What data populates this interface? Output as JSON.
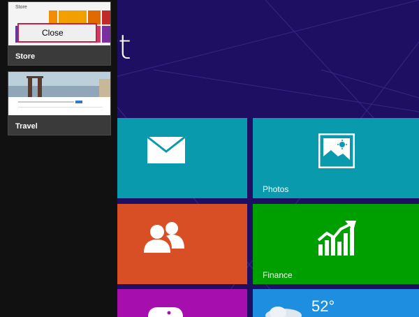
{
  "start": {
    "title": "art"
  },
  "tiles": {
    "mail": {
      "label": "",
      "icon": "mail-icon",
      "color": "#0a9aad"
    },
    "photos": {
      "label": "Photos",
      "icon": "photos-icon",
      "color": "#0a9aad"
    },
    "people": {
      "label": "",
      "icon": "people-icon",
      "color": "#d84f26"
    },
    "finance": {
      "label": "Finance",
      "icon": "finance-chart-icon",
      "color": "#009f00"
    },
    "games": {
      "label": "",
      "icon": "games-icon",
      "color": "#a60fae"
    },
    "weather": {
      "label": "",
      "temperature": "52°",
      "icon": "cloud-icon",
      "color": "#1e8fe0"
    }
  },
  "switcher": {
    "apps": [
      {
        "label": "Store",
        "preview_title": "Store"
      },
      {
        "label": "Travel"
      }
    ]
  },
  "context_menu": {
    "items": [
      {
        "label": "Close"
      }
    ],
    "border_color": "#c4214a"
  }
}
